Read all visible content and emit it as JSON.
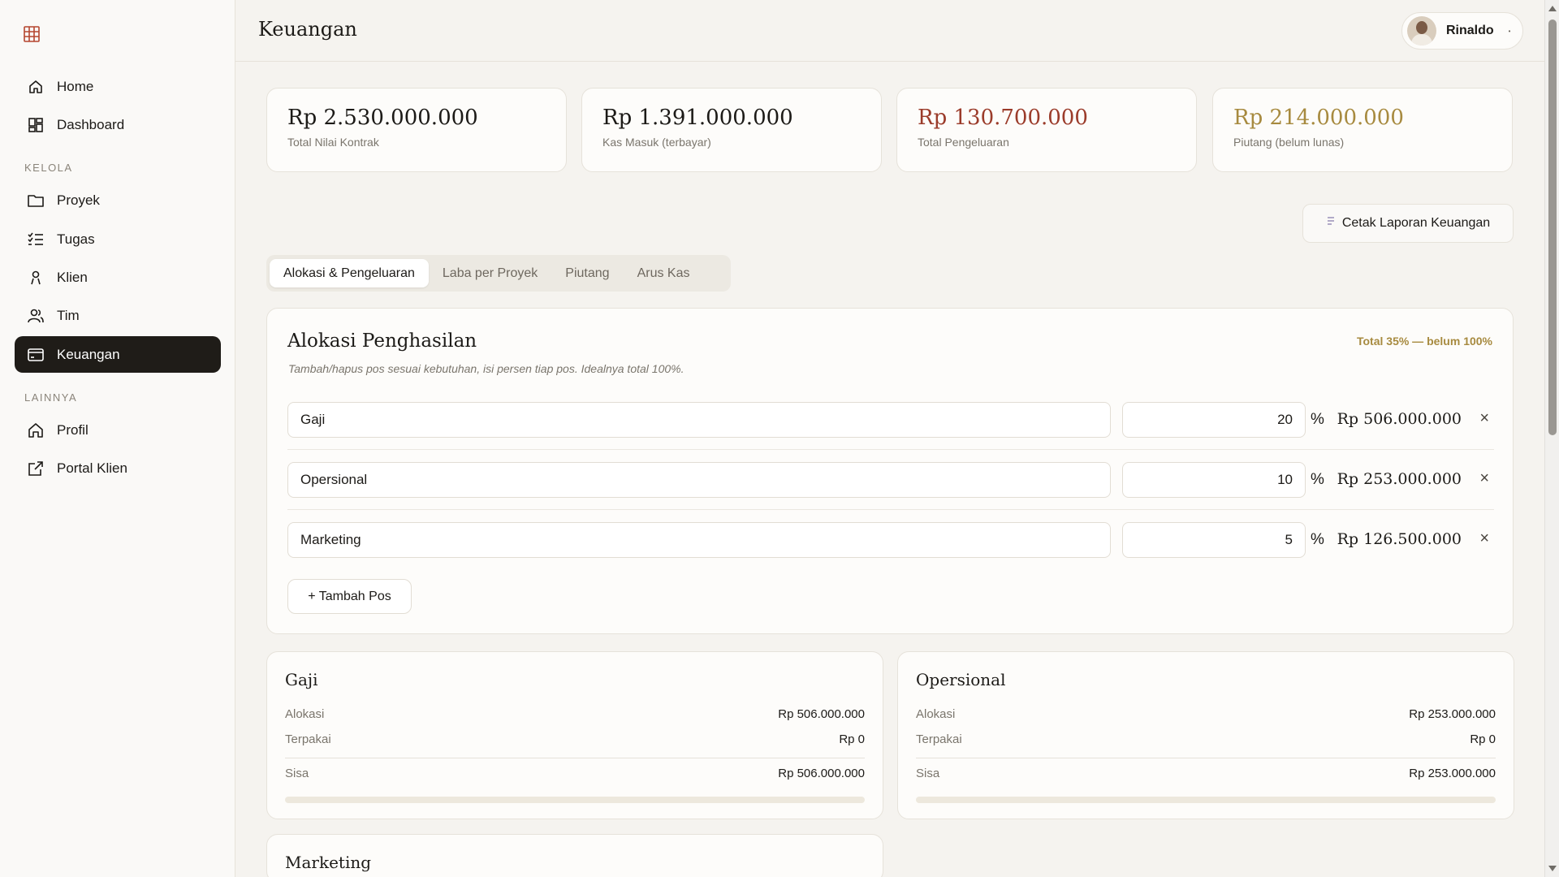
{
  "sidebar": {
    "items": [
      {
        "label": "Home",
        "icon": "home-icon"
      },
      {
        "label": "Dashboard",
        "icon": "dashboard-icon"
      },
      {
        "label": "Proyek",
        "icon": "folder-icon"
      },
      {
        "label": "Tugas",
        "icon": "checklist-icon"
      },
      {
        "label": "Klien",
        "icon": "person-icon"
      },
      {
        "label": "Tim",
        "icon": "team-icon"
      },
      {
        "label": "Keuangan",
        "icon": "card-icon",
        "active": true
      },
      {
        "label": "Profil",
        "icon": "profile-home-icon"
      },
      {
        "label": "Portal Klien",
        "icon": "external-link-icon"
      }
    ],
    "sections": [
      "KELOLA",
      "LAINNYA"
    ]
  },
  "header": {
    "title": "Keuangan",
    "user_name": "Rinaldo"
  },
  "stats": [
    {
      "value": "Rp 2.530.000.000",
      "label": "Total Nilai Kontrak",
      "color": "#1c1a17"
    },
    {
      "value": "Rp 1.391.000.000",
      "label": "Kas Masuk (terbayar)",
      "color": "#1c1a17"
    },
    {
      "value": "Rp 130.700.000",
      "label": "Total Pengeluaran",
      "color": "#9b3b2a"
    },
    {
      "value": "Rp 214.000.000",
      "label": "Piutang (belum lunas)",
      "color": "#a78a3f"
    }
  ],
  "actions": {
    "print_label": "Cetak Laporan Keuangan"
  },
  "tabs": [
    {
      "label": "Alokasi & Pengeluaran",
      "active": true
    },
    {
      "label": "Laba per Proyek"
    },
    {
      "label": "Piutang"
    },
    {
      "label": "Arus Kas"
    }
  ],
  "allocation": {
    "title": "Alokasi Penghasilan",
    "subtitle": "Tambah/hapus pos sesuai kebutuhan, isi persen tiap pos. Idealnya total 100%.",
    "total_note": "Total 35% — belum 100%",
    "percent_sign": "%",
    "remove_symbol": "×",
    "add_label": "+ Tambah Pos",
    "rows": [
      {
        "name": "Gaji",
        "percent": "20",
        "amount": "Rp 506.000.000"
      },
      {
        "name": "Opersional",
        "percent": "10",
        "amount": "Rp 253.000.000"
      },
      {
        "name": "Marketing",
        "percent": "5",
        "amount": "Rp 126.500.000"
      }
    ]
  },
  "categories": [
    {
      "title": "Gaji",
      "alokasi_label": "Alokasi",
      "alokasi": "Rp 506.000.000",
      "terpakai_label": "Terpakai",
      "terpakai": "Rp 0",
      "sisa_label": "Sisa",
      "sisa": "Rp 506.000.000",
      "used_fraction": 0
    },
    {
      "title": "Opersional",
      "alokasi_label": "Alokasi",
      "alokasi": "Rp 253.000.000",
      "terpakai_label": "Terpakai",
      "terpakai": "Rp 0",
      "sisa_label": "Sisa",
      "sisa": "Rp 253.000.000",
      "used_fraction": 0
    },
    {
      "title": "Marketing"
    }
  ]
}
